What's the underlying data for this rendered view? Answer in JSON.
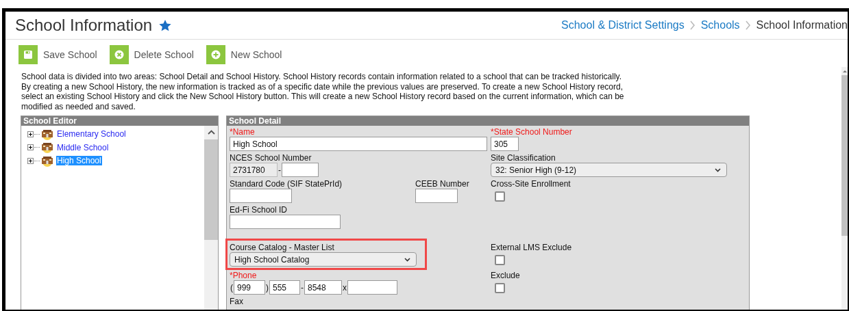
{
  "header": {
    "title": "School Information",
    "favorite": true,
    "breadcrumb": [
      {
        "label": "School & District Settings",
        "kind": "link"
      },
      {
        "label": "Schools",
        "kind": "link"
      },
      {
        "label": "School Information",
        "kind": "current"
      }
    ]
  },
  "toolbar": [
    {
      "label": "Save School",
      "kind": "save"
    },
    {
      "label": "Delete School",
      "kind": "delete"
    },
    {
      "label": "New School",
      "kind": "add"
    }
  ],
  "description": "School data is divided into two areas: School Detail and School History. School History records contain information related to a school that can be tracked historically. By creating a new School History, the new information is tracked as of a specific date while the previous values are preserved. To create a new School History record, select an existing School History and click the New School History button. This will create a new School History record based on the current information, which can be modified as needed and saved.",
  "school_editor": {
    "title": "School Editor",
    "items": [
      {
        "label": "Elementary School",
        "selected": false,
        "expanded": false
      },
      {
        "label": "Middle School",
        "selected": false,
        "expanded": false
      },
      {
        "label": "High School",
        "selected": true,
        "expanded": false
      }
    ]
  },
  "school_detail": {
    "title": "School Detail",
    "rows": [
      {
        "left": [
          {
            "kind": "text",
            "label": "*Name",
            "required": true,
            "value": "High School"
          }
        ],
        "right": [
          {
            "kind": "text",
            "label": "*State School Number",
            "required": true,
            "value": "305"
          }
        ]
      },
      {
        "left": [
          {
            "kind": "composite",
            "label": "NCES School Number",
            "required": false,
            "segments": [
              {
                "kind": "input",
                "value": "2731780",
                "readonly": true
              },
              {
                "kind": "sep",
                "text": "-"
              },
              {
                "kind": "input",
                "readonly": false
              }
            ]
          }
        ],
        "right": [
          {
            "kind": "select",
            "label": "Site Classification",
            "required": false,
            "value": "32: Senior High (9-12)"
          }
        ]
      },
      {
        "left": [
          {
            "kind": "text",
            "label": "Standard Code (SIF StatePrId)",
            "required": false
          },
          {
            "kind": "text",
            "label": "CEEB Number",
            "required": false
          }
        ],
        "right": [
          {
            "kind": "checkbox",
            "label": "Cross-Site Enrollment",
            "required": false,
            "checked": false
          }
        ]
      },
      {
        "left": [
          {
            "kind": "text",
            "label": "Ed-Fi School ID",
            "required": false
          }
        ],
        "right": []
      },
      {
        "left": [
          {
            "kind": "select",
            "label": "Course Catalog - Master List",
            "required": false,
            "value": "High School Catalog",
            "highlighted": true
          }
        ],
        "right": [
          {
            "kind": "checkbox",
            "label": "External LMS Exclude",
            "required": false,
            "checked": false
          }
        ]
      },
      {
        "left": [
          {
            "kind": "composite",
            "label": "*Phone",
            "required": true,
            "segments": [
              {
                "kind": "sep",
                "text": "("
              },
              {
                "kind": "input",
                "value": "999",
                "readonly": false
              },
              {
                "kind": "sep",
                "text": ")"
              },
              {
                "kind": "input",
                "value": "555",
                "readonly": false
              },
              {
                "kind": "sep",
                "text": "-"
              },
              {
                "kind": "input",
                "value": "8548",
                "readonly": false
              },
              {
                "kind": "sep",
                "text": "x"
              },
              {
                "kind": "input",
                "readonly": false
              }
            ]
          }
        ],
        "right": [
          {
            "kind": "checkbox",
            "label": "Exclude",
            "required": false,
            "checked": false
          }
        ]
      },
      {
        "left": [
          {
            "kind": "text",
            "label": "Fax",
            "required": false
          }
        ],
        "right": []
      }
    ]
  }
}
